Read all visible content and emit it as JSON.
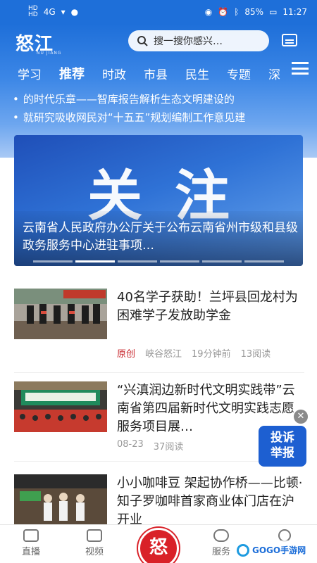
{
  "status_bar": {
    "sim1": "HD",
    "sim2": "HD",
    "net": "4G",
    "battery": "85%",
    "time": "11:27"
  },
  "app": {
    "logo_text": "怒江",
    "logo_sub": "NU JIANG"
  },
  "search": {
    "placeholder": "搜一搜你感兴…"
  },
  "tabs": [
    {
      "label": "学习",
      "active": false
    },
    {
      "label": "推荐",
      "active": true
    },
    {
      "label": "时政",
      "active": false
    },
    {
      "label": "市县",
      "active": false
    },
    {
      "label": "民生",
      "active": false
    },
    {
      "label": "专题",
      "active": false
    },
    {
      "label": "深",
      "active": false
    }
  ],
  "ticker": [
    "的时代乐章——智库报告解析生态文明建设的",
    "就研究吸收网民对“十五五”规划编制工作意见建"
  ],
  "banner": {
    "big_text": "关注",
    "caption": "云南省人民政府办公厅关于公布云南省州市级和县级政务服务中心进驻事项…",
    "dots": 6,
    "active_dot": 1
  },
  "news": [
    {
      "title": "40名学子获助！兰坪县回龙村为困难学子发放助学金",
      "tag": "原创",
      "source": "峡谷怒江",
      "time": "19分钟前",
      "reads": "13阅读"
    },
    {
      "title": "“兴滇润边新时代文明实践带”云南省第四届新时代文明实践志愿服务项目展…",
      "tag": "",
      "source": "",
      "time": "08-23",
      "reads": "37阅读"
    },
    {
      "title": "小小咖啡豆 架起协作桥——比顿·知子罗咖啡首家商业体门店在沪开业",
      "tag": "",
      "source": "",
      "time": "",
      "reads": ""
    }
  ],
  "report_button": {
    "line1": "投诉",
    "line2": "举报"
  },
  "bottom_nav": {
    "live": "直播",
    "video": "视频",
    "center": "怒",
    "service": "服务"
  },
  "watermark": "GOGO手游网",
  "colors": {
    "brand_blue": "#1e6fd9",
    "accent_red": "#c8262c"
  }
}
